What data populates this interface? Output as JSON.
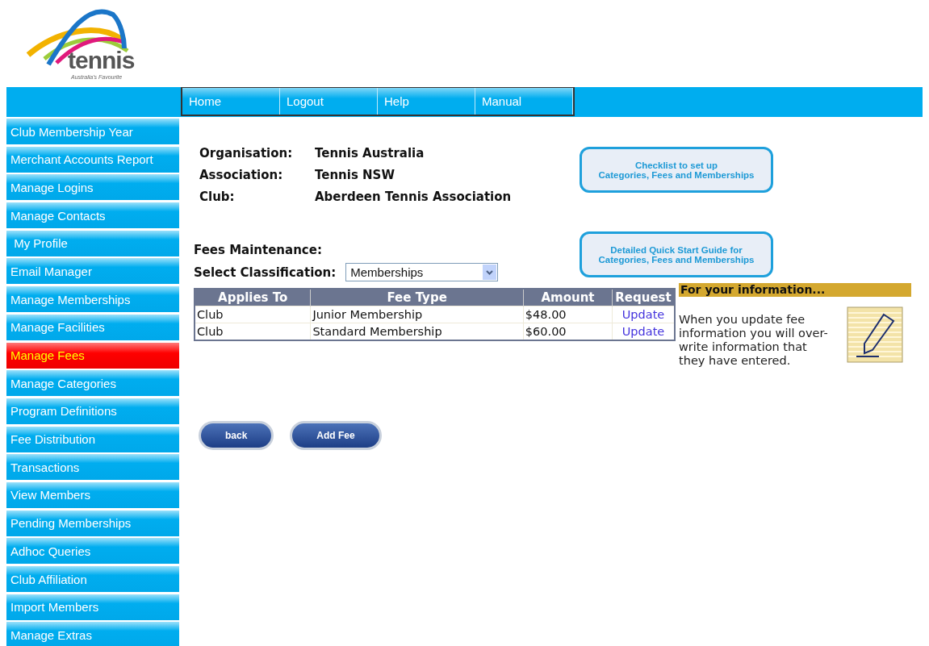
{
  "logo": {
    "name": "tennis",
    "tagline": "Australia's Favourite"
  },
  "nav": [
    {
      "label": "Home"
    },
    {
      "label": "Logout"
    },
    {
      "label": "Help"
    },
    {
      "label": "Manual"
    }
  ],
  "sidebar": {
    "items": [
      {
        "label": "Club Membership Year",
        "selected": false
      },
      {
        "label": "Merchant Accounts Report",
        "selected": false
      },
      {
        "label": "Manage Logins",
        "selected": false
      },
      {
        "label": "Manage Contacts",
        "selected": false
      },
      {
        "label": " My Profile",
        "selected": false
      },
      {
        "label": "Email Manager",
        "selected": false
      },
      {
        "label": "Manage Memberships",
        "selected": false
      },
      {
        "label": "Manage Facilities",
        "selected": false
      },
      {
        "label": "Manage Fees",
        "selected": true
      },
      {
        "label": "Manage Categories",
        "selected": false
      },
      {
        "label": "Program Definitions",
        "selected": false
      },
      {
        "label": "Fee Distribution",
        "selected": false
      },
      {
        "label": "Transactions",
        "selected": false
      },
      {
        "label": "View Members",
        "selected": false
      },
      {
        "label": "Pending Memberships",
        "selected": false
      },
      {
        "label": "Adhoc Queries",
        "selected": false
      },
      {
        "label": "Club Affiliation",
        "selected": false
      },
      {
        "label": "Import Members",
        "selected": false
      },
      {
        "label": "Manage Extras",
        "selected": false
      }
    ]
  },
  "details": [
    {
      "label": "Organisation:",
      "value": "Tennis Australia"
    },
    {
      "label": "Association:",
      "value": "Tennis NSW"
    },
    {
      "label": "Club:",
      "value": "Aberdeen Tennis Association"
    }
  ],
  "guide_buttons": [
    {
      "lines": [
        "Checklist to set up",
        "Categories, Fees and Memberships"
      ]
    },
    {
      "lines": [
        "Detailed  Quick Start Guide for",
        "Categories, Fees and Memberships"
      ]
    }
  ],
  "section_title": "Fees Maintenance:",
  "classification": {
    "label": "Select Classification:",
    "value": "Memberships"
  },
  "table": {
    "columns": [
      "Applies To",
      "Fee Type",
      "Amount",
      "Request"
    ],
    "rows": [
      {
        "applies_to": "Club",
        "fee_type": "Junior Membership",
        "amount": "$48.00",
        "request": "Update"
      },
      {
        "applies_to": "Club",
        "fee_type": "Standard Membership",
        "amount": "$60.00",
        "request": "Update"
      }
    ]
  },
  "info": {
    "title": "For your information...",
    "text": "When you update fee information you will over-write information that they have entered."
  },
  "buttons": [
    "back",
    "Add Fee"
  ]
}
